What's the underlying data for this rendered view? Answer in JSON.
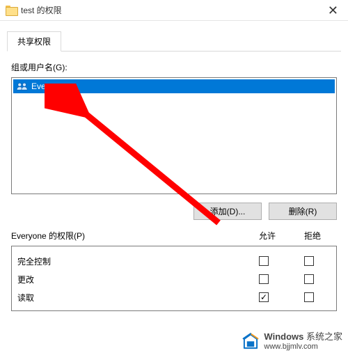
{
  "title": "test 的权限",
  "tab_label": "共享权限",
  "groups_label": "组或用户名(G):",
  "user_entry": "Everyone",
  "buttons": {
    "add": "添加(D)...",
    "remove": "删除(R)"
  },
  "perm_title_prefix": "Everyone 的权限(P)",
  "columns": {
    "allow": "允许",
    "deny": "拒绝"
  },
  "permissions": [
    {
      "name": "完全控制",
      "allow": false,
      "deny": false
    },
    {
      "name": "更改",
      "allow": false,
      "deny": false
    },
    {
      "name": "读取",
      "allow": true,
      "deny": false
    }
  ],
  "watermark": {
    "brand_html": "Windows 系统之家",
    "url": "www.bjjmlv.com"
  }
}
